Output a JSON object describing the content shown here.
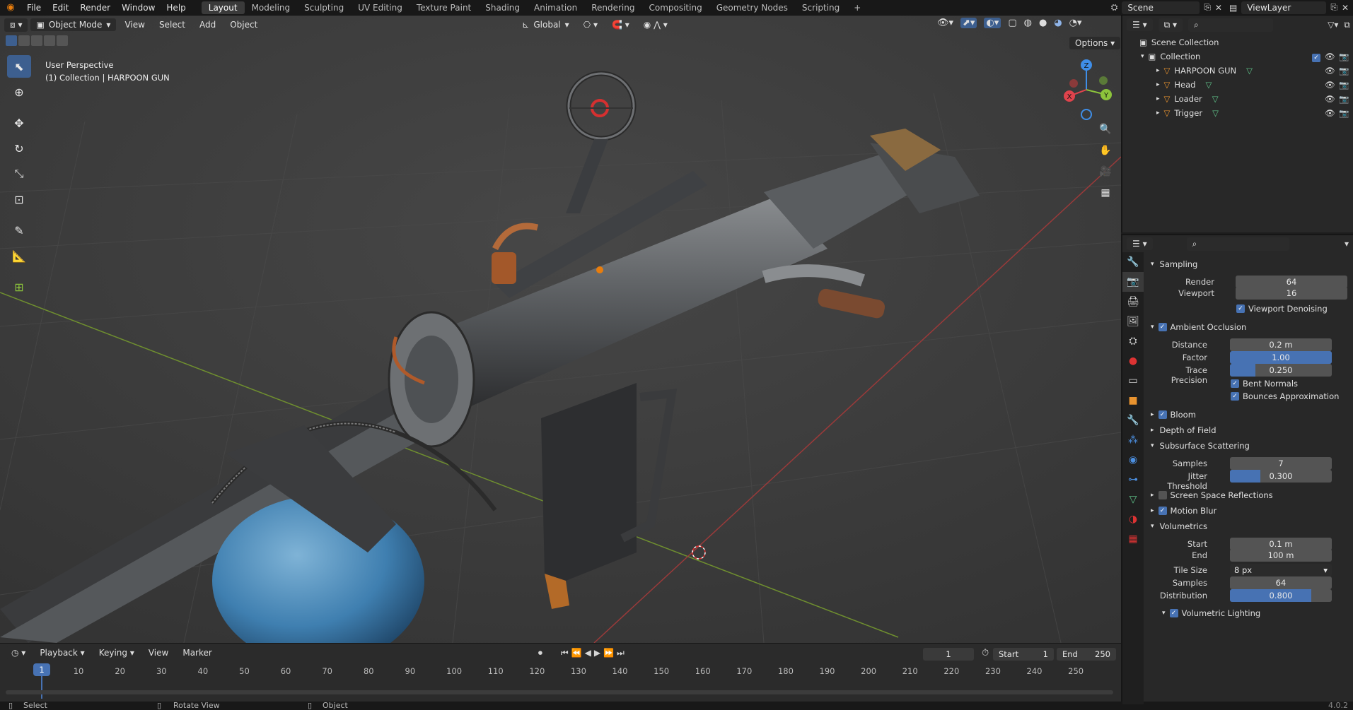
{
  "topbar": {
    "menus": [
      "File",
      "Edit",
      "Render",
      "Window",
      "Help"
    ],
    "workspaces": [
      "Layout",
      "Modeling",
      "Sculpting",
      "UV Editing",
      "Texture Paint",
      "Shading",
      "Animation",
      "Rendering",
      "Compositing",
      "Geometry Nodes",
      "Scripting"
    ],
    "active_workspace": "Layout",
    "add_tab": "+",
    "scene": "Scene",
    "view_layer": "ViewLayer"
  },
  "viewport": {
    "mode": "Object Mode",
    "menus": [
      "View",
      "Select",
      "Add",
      "Object"
    ],
    "transform_orientation": "Global",
    "options_label": "Options",
    "overlay_title": "User Perspective",
    "overlay_subtitle": "(1) Collection | HARPOON GUN",
    "gizmo": {
      "x": "X",
      "y": "Y",
      "z": "Z"
    }
  },
  "outliner": {
    "root": "Scene Collection",
    "collection": "Collection",
    "objects": [
      "HARPOON GUN",
      "Head",
      "Loader",
      "Trigger"
    ]
  },
  "properties": {
    "sampling": {
      "title": "Sampling",
      "render_label": "Render",
      "render_value": "64",
      "viewport_label": "Viewport",
      "viewport_value": "16",
      "denoise_label": "Viewport Denoising"
    },
    "ao": {
      "title": "Ambient Occlusion",
      "distance_label": "Distance",
      "distance_value": "0.2 m",
      "factor_label": "Factor",
      "factor_value": "1.00",
      "factor_fraction": 1.0,
      "trace_label": "Trace Precision",
      "trace_value": "0.250",
      "trace_fraction": 0.25,
      "bent_label": "Bent Normals",
      "bounces_label": "Bounces Approximation"
    },
    "bloom": "Bloom",
    "dof": "Depth of Field",
    "sss": {
      "title": "Subsurface Scattering",
      "samples_label": "Samples",
      "samples_value": "7",
      "jitter_label": "Jitter Threshold",
      "jitter_value": "0.300",
      "jitter_fraction": 0.3
    },
    "ssr": "Screen Space Reflections",
    "motion_blur": "Motion Blur",
    "volumetrics": {
      "title": "Volumetrics",
      "start_label": "Start",
      "start_value": "0.1 m",
      "end_label": "End",
      "end_value": "100 m",
      "tile_label": "Tile Size",
      "tile_value": "8 px",
      "samples_label": "Samples",
      "samples_value": "64",
      "dist_label": "Distribution",
      "dist_value": "0.800",
      "dist_fraction": 0.8,
      "lighting_label": "Volumetric Lighting"
    }
  },
  "timeline": {
    "menus": [
      "Playback",
      "Keying",
      "View",
      "Marker"
    ],
    "current_frame": "1",
    "start_label": "Start",
    "start_value": "1",
    "end_label": "End",
    "end_value": "250",
    "ticks": [
      "10",
      "20",
      "30",
      "40",
      "50",
      "60",
      "70",
      "80",
      "90",
      "100",
      "110",
      "120",
      "130",
      "140",
      "150",
      "160",
      "170",
      "180",
      "190",
      "200",
      "210",
      "220",
      "230",
      "240",
      "250"
    ],
    "cursor_frame": "1"
  },
  "statusbar": {
    "select": "Select",
    "rotate": "Rotate View",
    "object": "Object",
    "version": "4.0.2"
  },
  "colors": {
    "accent": "#4772b3",
    "active_tool": "#3d5f8f",
    "x_axis": "#e0434c",
    "y_axis": "#8cc43b",
    "z_axis": "#3f8ee8"
  }
}
